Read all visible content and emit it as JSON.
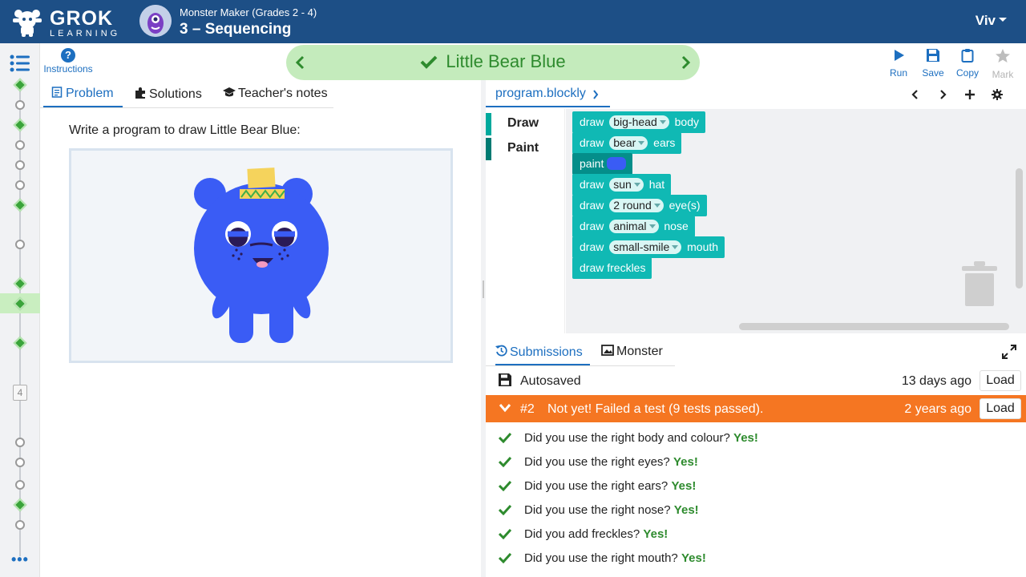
{
  "header": {
    "logo_word1": "GROK",
    "logo_word2": "LEARNING",
    "course": "Monster Maker (Grades 2 - 4)",
    "lesson": "3 – Sequencing",
    "user": "Viv"
  },
  "toolbar": {
    "instructions_label": "Instructions",
    "problem_title": "Little Bear Blue",
    "run_label": "Run",
    "save_label": "Save",
    "copy_label": "Copy",
    "mark_label": "Mark"
  },
  "rail": {
    "step_number": "4",
    "more": "•••"
  },
  "left_panel": {
    "tabs": [
      {
        "label": "Problem"
      },
      {
        "label": "Solutions"
      },
      {
        "label": "Teacher's notes"
      }
    ],
    "prompt": "Write a program to draw Little Bear Blue:"
  },
  "editor": {
    "file_tab": "program.blockly",
    "categories": [
      {
        "label": "Draw"
      },
      {
        "label": "Paint"
      }
    ],
    "blocks": [
      {
        "pre": "draw",
        "option": "big-head",
        "post": "body"
      },
      {
        "pre": "draw",
        "option": "bear",
        "post": "ears"
      },
      {
        "pre": "paint",
        "color": "#3a5cf5"
      },
      {
        "pre": "draw",
        "option": "sun",
        "post": "hat"
      },
      {
        "pre": "draw",
        "option": "2 round",
        "post": "eye(s)"
      },
      {
        "pre": "draw",
        "option": "animal",
        "post": "nose"
      },
      {
        "pre": "draw",
        "option": "small-smile",
        "post": "mouth"
      },
      {
        "pre": "draw freckles"
      }
    ]
  },
  "submissions": {
    "tabs": [
      {
        "label": "Submissions"
      },
      {
        "label": "Monster"
      }
    ],
    "autosave": {
      "label": "Autosaved",
      "time": "13 days ago",
      "action": "Load"
    },
    "latest": {
      "number": "#2",
      "message": "Not yet! Failed a test (9 tests passed).",
      "time": "2 years ago",
      "action": "Load"
    },
    "checks": [
      {
        "question": "Did you use the right body and colour?",
        "answer": "Yes!"
      },
      {
        "question": "Did you use the right eyes?",
        "answer": "Yes!"
      },
      {
        "question": "Did you use the right ears?",
        "answer": "Yes!"
      },
      {
        "question": "Did you use the right nose?",
        "answer": "Yes!"
      },
      {
        "question": "Did you add freckles?",
        "answer": "Yes!"
      },
      {
        "question": "Did you use the right mouth?",
        "answer": "Yes!"
      }
    ]
  },
  "colors": {
    "header_bg": "#1d4f86",
    "accent": "#1d6fc0",
    "success": "#2e8b2e",
    "fail_bg": "#f57622",
    "block_teal": "#10b9b4",
    "monster_blue": "#3a5cf5"
  }
}
